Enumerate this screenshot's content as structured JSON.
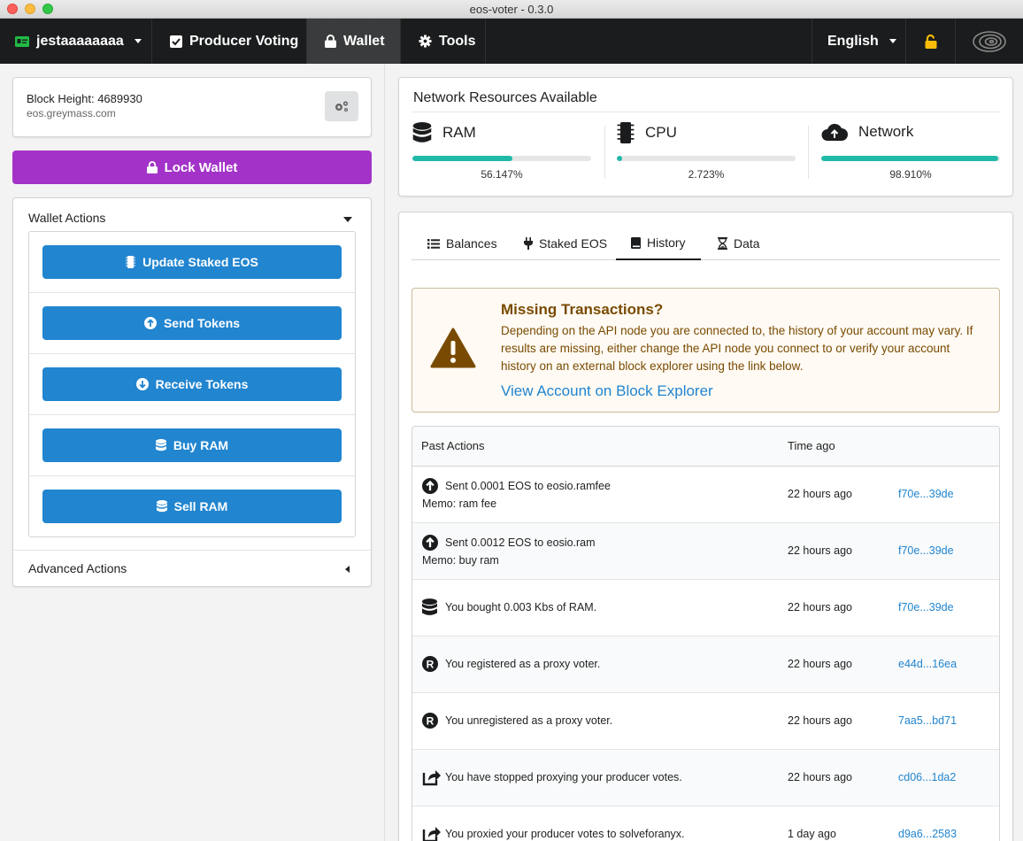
{
  "window": {
    "title": "eos-voter - 0.3.0"
  },
  "menu": {
    "account": "jestaaaaaaaa",
    "producer_voting": "Producer Voting",
    "wallet": "Wallet",
    "tools": "Tools",
    "language": "English"
  },
  "block": {
    "height_label": "Block Height: 4689930",
    "host": "eos.greymass.com"
  },
  "lock_wallet": "Lock Wallet",
  "wallet_actions": {
    "title": "Wallet Actions",
    "buttons": [
      "Update Staked EOS",
      "Send Tokens",
      "Receive Tokens",
      "Buy RAM",
      "Sell RAM"
    ],
    "advanced": "Advanced Actions"
  },
  "network": {
    "title": "Network Resources Available",
    "resources": [
      {
        "name": "RAM",
        "percent_label": "56.147%",
        "percent": 56.147
      },
      {
        "name": "CPU",
        "percent_label": "2.723%",
        "percent": 2.723
      },
      {
        "name": "Network",
        "percent_label": "98.910%",
        "percent": 98.91
      }
    ],
    "bar_color": "#21b9a8"
  },
  "tabs": [
    "Balances",
    "Staked EOS",
    "History",
    "Data"
  ],
  "active_tab": "History",
  "warning": {
    "title": "Missing Transactions?",
    "body": "Depending on the API node you are connected to, the history of your account may vary. If results are missing, either change the API node you connect to or verify your account history on an external block explorer using the link below.",
    "link": "View Account on Block Explorer"
  },
  "history": {
    "col_action": "Past Actions",
    "col_time": "Time ago",
    "rows": [
      {
        "icon": "arrow-up-circle-icon",
        "text": "Sent 0.0001 EOS to eosio.ramfee",
        "memo": "Memo: ram fee",
        "time": "22 hours ago",
        "tx": "f70e...39de"
      },
      {
        "icon": "arrow-up-circle-icon",
        "text": "Sent 0.0012 EOS to eosio.ram",
        "memo": "Memo: buy ram",
        "time": "22 hours ago",
        "tx": "f70e...39de"
      },
      {
        "icon": "database-icon",
        "text": "You bought 0.003 Kbs of RAM.",
        "memo": "",
        "time": "22 hours ago",
        "tx": "f70e...39de"
      },
      {
        "icon": "registered-icon",
        "text": "You registered as a proxy voter.",
        "memo": "",
        "time": "22 hours ago",
        "tx": "e44d...16ea"
      },
      {
        "icon": "registered-icon",
        "text": "You unregistered as a proxy voter.",
        "memo": "",
        "time": "22 hours ago",
        "tx": "7aa5...bd71"
      },
      {
        "icon": "share-icon",
        "text": "You have stopped proxying your producer votes.",
        "memo": "",
        "time": "22 hours ago",
        "tx": "cd06...1da2"
      },
      {
        "icon": "share-icon",
        "text": "You proxied your producer votes to solveforanyx.",
        "memo": "",
        "time": "1 day ago",
        "tx": "d9a6...2583"
      }
    ]
  },
  "colors": {
    "primary": "#2185d0",
    "lock": "#a333c8",
    "menu_bg": "#1b1c1d",
    "warning_text": "#794b02",
    "lock_icon": "#fbbd08"
  }
}
